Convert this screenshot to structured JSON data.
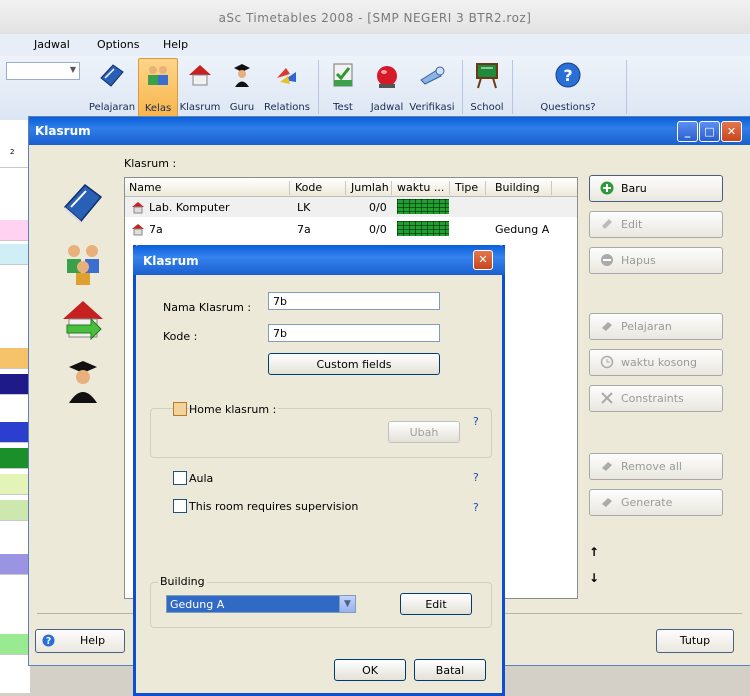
{
  "app": {
    "title": "aSc Timetables 2008  - [SMP NEGERI 3 BTR2.roz]"
  },
  "menu": [
    "Jadwal",
    "Options",
    "Help"
  ],
  "ribbon": {
    "groups": [
      [
        {
          "label": "Pelajaran",
          "icon": "book-icon"
        },
        {
          "label": "Kelas",
          "icon": "class-group-icon",
          "active": true
        },
        {
          "label": "Klasrum",
          "icon": "house-icon"
        },
        {
          "label": "Guru",
          "icon": "graduate-icon"
        },
        {
          "label": "Relations",
          "icon": "relations-icon"
        }
      ],
      [
        {
          "label": "Test",
          "icon": "test-icon"
        },
        {
          "label": "Jadwal",
          "icon": "alarm-icon"
        },
        {
          "label": "Verifikasi",
          "icon": "verify-icon"
        }
      ],
      [
        {
          "label": "School",
          "icon": "school-board-icon"
        }
      ],
      [
        {
          "label": "Questions?",
          "icon": "question-icon"
        }
      ]
    ]
  },
  "klasrum_window": {
    "title": "Klasrum",
    "list_label": "Klasrum :",
    "columns": [
      "Name",
      "Kode",
      "Jumlah",
      "waktu ...",
      "Tipe",
      "Building"
    ],
    "rows": [
      {
        "name": "Lab. Komputer",
        "kode": "LK",
        "jumlah": "0/0",
        "tipe": "",
        "building": ""
      },
      {
        "name": "7a",
        "kode": "7a",
        "jumlah": "0/0",
        "tipe": "",
        "building": "Gedung A"
      }
    ],
    "buttons": {
      "baru": "Baru",
      "edit": "Edit",
      "hapus": "Hapus",
      "pelajaran": "Pelajaran",
      "waktu_kosong": "waktu kosong",
      "constraints": "Constraints",
      "remove_all": "Remove all",
      "generate": "Generate"
    },
    "arrows": {
      "up": "↑",
      "down": "↓"
    },
    "help": "Help",
    "tutup": "Tutup",
    "strip_left_label": "2"
  },
  "dialog": {
    "title": "Klasrum",
    "nama_label": "Nama Klasrum :",
    "nama_value": "7b",
    "kode_label": "Kode :",
    "kode_value": "7b",
    "custom_fields": "Custom fields",
    "home_klasrum": "Home klasrum :",
    "ubah": "Ubah",
    "aula": "Aula",
    "supervision": "This room requires supervision",
    "question": "?",
    "building_label": "Building",
    "building_value": "Gedung A",
    "edit": "Edit",
    "ok": "OK",
    "batal": "Batal"
  },
  "colors": {
    "title_blue": "#0a5fd9",
    "selection": "#316ac5",
    "grid_green": "#1fa02f",
    "active_ribbon": "#f7b54a"
  }
}
